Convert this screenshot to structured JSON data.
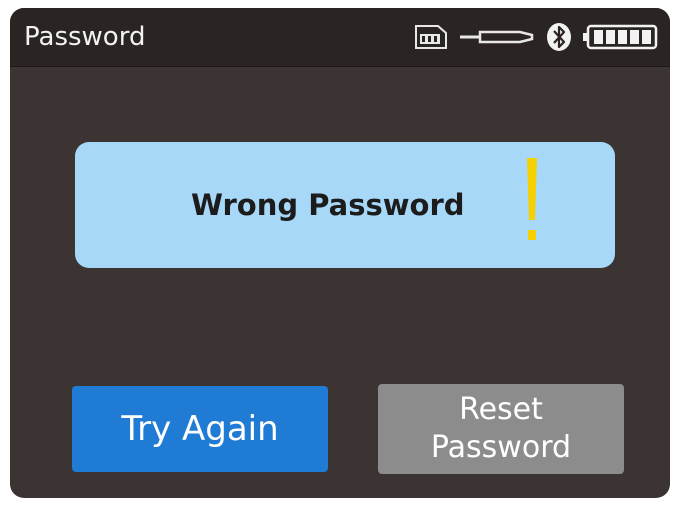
{
  "header": {
    "title": "Password",
    "icons": [
      "microsd-card-icon",
      "usb-cable-icon",
      "bluetooth-icon",
      "battery-full-icon"
    ]
  },
  "message": {
    "text": "Wrong Password",
    "icon": "exclamation-icon",
    "background_color": "#a8d8f8",
    "icon_color": "#f5d000"
  },
  "buttons": {
    "try_again": "Try Again",
    "reset_password": "Reset\nPassword"
  },
  "colors": {
    "screen_background": "#3b3433",
    "primary_button": "#1f7bd4",
    "secondary_button": "#8c8c8c"
  }
}
